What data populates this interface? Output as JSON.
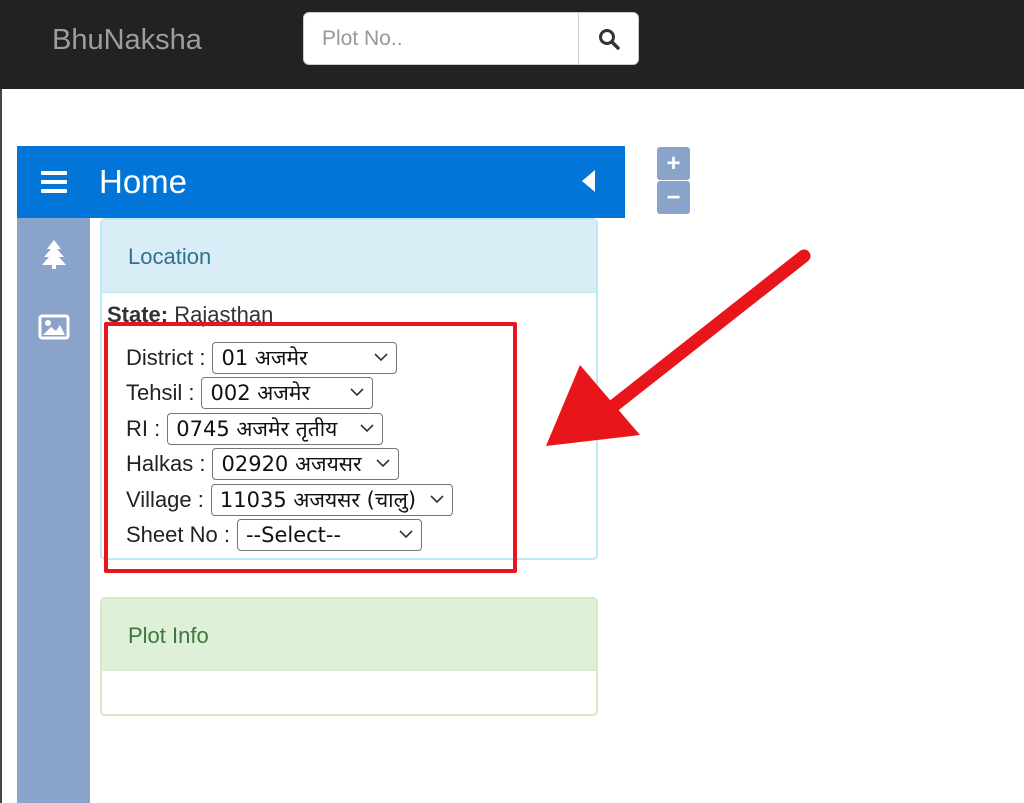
{
  "header": {
    "brand": "BhuNaksha",
    "search_placeholder": "Plot No..",
    "search_icon": "magnifier-icon"
  },
  "panel": {
    "title": "Home",
    "menu_icon": "hamburger-icon",
    "collapse_icon": "caret-left-icon"
  },
  "rail": {
    "icons": [
      "tree-icon",
      "image-icon"
    ]
  },
  "zoom": {
    "in_label": "+",
    "out_label": "−"
  },
  "location": {
    "title": "Location",
    "state_label": "State:",
    "state_value": "Rajasthan",
    "fields": [
      {
        "label": "District :",
        "value": "01 अजमेर"
      },
      {
        "label": "Tehsil :",
        "value": "002 अजमेर"
      },
      {
        "label": "RI :",
        "value": "0745 अजमेर तृतीय"
      },
      {
        "label": "Halkas :",
        "value": "02920 अजयसर"
      },
      {
        "label": "Village :",
        "value": "11035 अजयसर (चालु)"
      },
      {
        "label": "Sheet No :",
        "value": "--Select--"
      }
    ]
  },
  "plot_info": {
    "title": "Plot Info"
  },
  "colors": {
    "topbar": "#222222",
    "header_blue": "#0275d8",
    "rail": "#8aa3cb",
    "annotation_red": "#e8151a"
  }
}
